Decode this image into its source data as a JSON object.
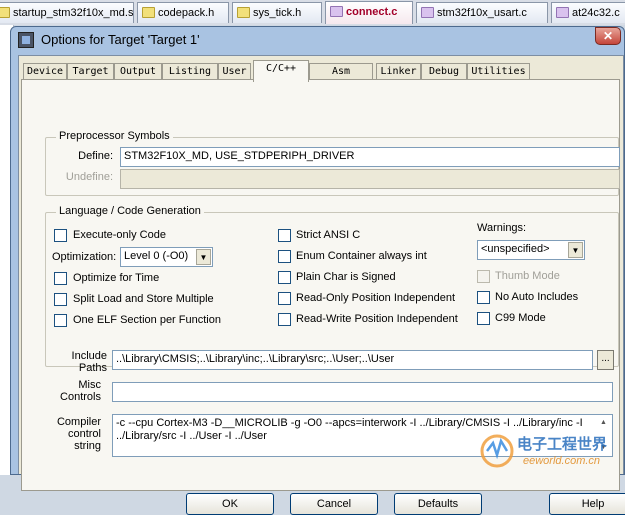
{
  "file_tabs": [
    {
      "label": "startup_stm32f10x_md.s",
      "kind": "y"
    },
    {
      "label": "codepack.h",
      "kind": "y"
    },
    {
      "label": "sys_tick.h",
      "kind": "y"
    },
    {
      "label": "connect.c",
      "kind": "p",
      "active": true
    },
    {
      "label": "stm32f10x_usart.c",
      "kind": "p"
    },
    {
      "label": "at24c32.c",
      "kind": "p"
    }
  ],
  "dialog": {
    "title": "Options for Target 'Target 1'",
    "close_glyph": "✕"
  },
  "option_tabs": [
    "Device",
    "Target",
    "Output",
    "Listing",
    "User",
    "C/C++",
    "Asm",
    "Linker",
    "Debug",
    "Utilities"
  ],
  "active_tab": "C/C++",
  "preprocessor": {
    "group_label": "Preprocessor Symbols",
    "define_label": "Define:",
    "define_value": "STM32F10X_MD, USE_STDPERIPH_DRIVER",
    "undefine_label": "Undefine:",
    "undefine_value": ""
  },
  "codegen": {
    "group_label": "Language / Code Generation",
    "execute_only": "Execute-only Code",
    "optimization_label": "Optimization:",
    "optimization_value": "Level 0 (-O0)",
    "optimize_time": "Optimize for Time",
    "split_load": "Split Load and Store Multiple",
    "one_elf": "One ELF Section per Function",
    "strict_ansi": "Strict ANSI C",
    "enum_container": "Enum Container always int",
    "plain_char": "Plain Char is Signed",
    "ro_pos": "Read-Only Position Independent",
    "rw_pos": "Read-Write Position Independent",
    "warnings_label": "Warnings:",
    "warnings_value": "<unspecified>",
    "thumb_mode": "Thumb Mode",
    "no_auto_includes": "No Auto Includes",
    "c99_mode": "C99 Mode"
  },
  "paths": {
    "include_label_1": "Include",
    "include_label_2": "Paths",
    "include_value": "..\\Library\\CMSIS;..\\Library\\inc;..\\Library\\src;..\\User;..\\User",
    "browse_label": "...",
    "misc_label_1": "Misc",
    "misc_label_2": "Controls",
    "misc_value": "",
    "compiler_label_1": "Compiler",
    "compiler_label_2": "control",
    "compiler_label_3": "string",
    "compiler_value": "-c --cpu Cortex-M3 -D__MICROLIB -g -O0 --apcs=interwork -I ../Library/CMSIS -I ../Library/inc -I ../Library/src -I ../User -I ../User"
  },
  "buttons": {
    "ok": "OK",
    "cancel": "Cancel",
    "defaults": "Defaults",
    "help": "Help"
  },
  "watermark": {
    "cn": "电子工程世界",
    "en": "eeworld.com.cn"
  }
}
